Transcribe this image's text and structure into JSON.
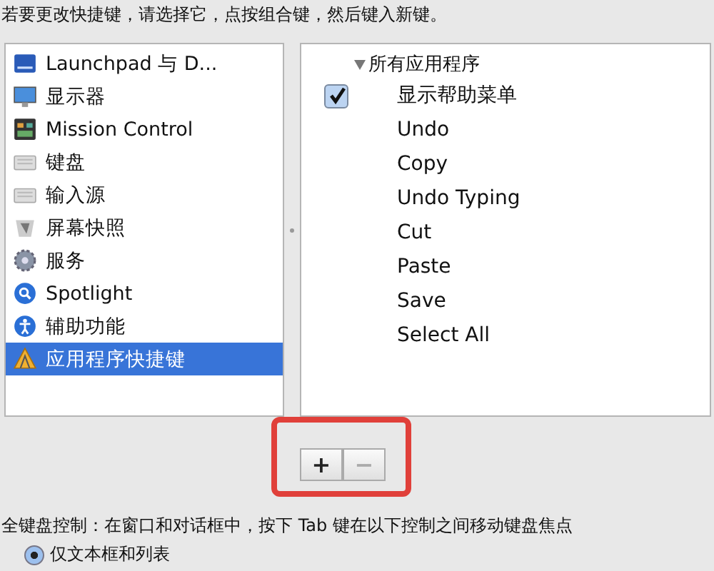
{
  "instruction": "若要更改快捷键，请选择它，点按组合键，然后键入新键。",
  "categories": [
    {
      "label": "Launchpad 与 D...",
      "selected": false
    },
    {
      "label": "显示器",
      "selected": false
    },
    {
      "label": "Mission Control",
      "selected": false
    },
    {
      "label": "键盘",
      "selected": false
    },
    {
      "label": "输入源",
      "selected": false
    },
    {
      "label": "屏幕快照",
      "selected": false
    },
    {
      "label": "服务",
      "selected": false
    },
    {
      "label": "Spotlight",
      "selected": false
    },
    {
      "label": "辅助功能",
      "selected": false
    },
    {
      "label": "应用程序快捷键",
      "selected": true
    }
  ],
  "shortcuts": {
    "group": {
      "label": "所有应用程序",
      "expanded": true
    },
    "items": [
      {
        "label": "显示帮助菜单",
        "kind": "checkbox",
        "checked": true
      },
      {
        "label": "Undo",
        "kind": "item"
      },
      {
        "label": "Copy",
        "kind": "item"
      },
      {
        "label": "Undo Typing",
        "kind": "item"
      },
      {
        "label": "Cut",
        "kind": "item"
      },
      {
        "label": "Paste",
        "kind": "item"
      },
      {
        "label": "Save",
        "kind": "item"
      },
      {
        "label": "Select All",
        "kind": "item"
      }
    ]
  },
  "buttons": [
    {
      "label": "+",
      "disabled": false
    },
    {
      "label": "−",
      "disabled": true
    }
  ],
  "keyboard_control": {
    "text": "全键盘控制：在窗口和对话框中，按下 Tab 键在以下控制之间移动键盘焦点",
    "options": [
      {
        "label": "仅文本框和列表",
        "selected": true
      }
    ]
  }
}
